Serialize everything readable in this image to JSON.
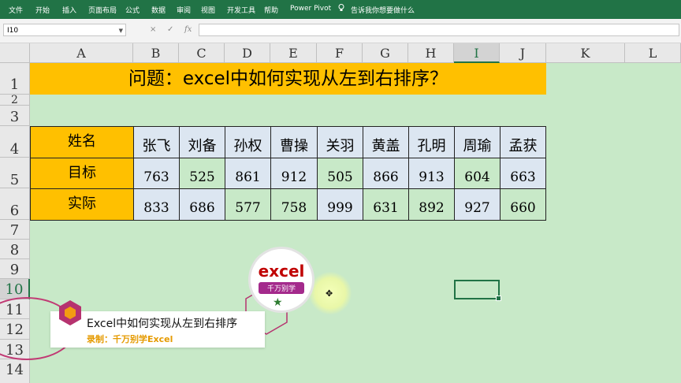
{
  "ribbon": {
    "tabs": [
      "文件",
      "开始",
      "插入",
      "页面布局",
      "公式",
      "数据",
      "审阅",
      "视图",
      "开发工具",
      "帮助",
      "Power Pivot"
    ],
    "tell_me": "告诉我你想要做什么"
  },
  "formula_bar": {
    "name_box": "I10",
    "cancel": "×",
    "enter": "✓",
    "fx": "fx",
    "value": ""
  },
  "columns": [
    "A",
    "B",
    "C",
    "D",
    "E",
    "F",
    "G",
    "H",
    "I",
    "J",
    "K",
    "L"
  ],
  "rows": [
    "1",
    "2",
    "3",
    "4",
    "5",
    "6",
    "7",
    "8",
    "9",
    "10",
    "11",
    "12",
    "13",
    "14"
  ],
  "sheet": {
    "title": "问题：excel中如何实现从左到右排序？",
    "row_labels": [
      "姓名",
      "目标",
      "实际"
    ],
    "names": [
      "张飞",
      "刘备",
      "孙权",
      "曹操",
      "关羽",
      "黄盖",
      "孔明",
      "周瑜",
      "孟获"
    ],
    "target": [
      "763",
      "525",
      "861",
      "912",
      "505",
      "866",
      "913",
      "604",
      "663"
    ],
    "actual": [
      "833",
      "686",
      "577",
      "758",
      "999",
      "631",
      "892",
      "927",
      "660"
    ]
  },
  "selected_cell": "I10",
  "watermark": {
    "logo_top": "excel",
    "logo_bottom": "千万别学"
  },
  "caption": {
    "title": "Excel中如何实现从左到右排序",
    "subtitle": "录制：千万别学Excel"
  },
  "colors": {
    "ribbon": "#217346",
    "header_fill": "#ffc000",
    "data_fill": "#dce6f1",
    "sheet_bg": "#c8e9c8"
  }
}
